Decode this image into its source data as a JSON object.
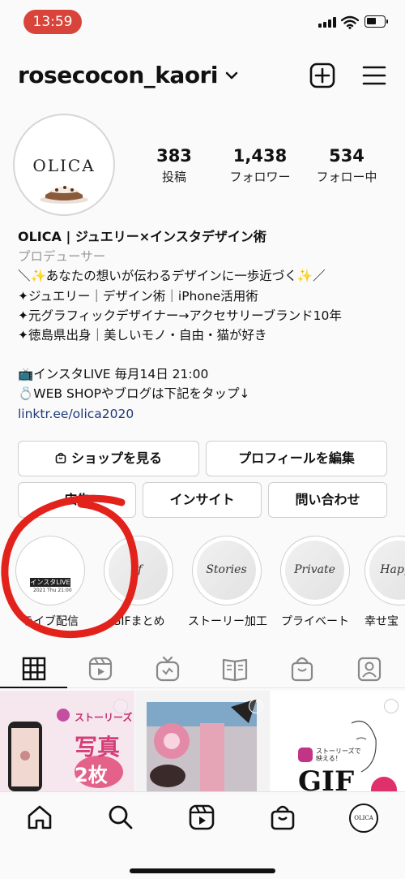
{
  "status": {
    "time": "13:59"
  },
  "header": {
    "username": "rosecocon_kaori"
  },
  "profile": {
    "avatar_logo": "OLICA",
    "stats": [
      {
        "value": "383",
        "label": "投稿"
      },
      {
        "value": "1,438",
        "label": "フォロワー"
      },
      {
        "value": "534",
        "label": "フォロー中"
      }
    ]
  },
  "bio": {
    "name": "OLICA | ジュエリー×インスタデザイン術",
    "category": "プロデューサー",
    "lines": [
      "＼✨あなたの想いが伝わるデザインに一歩近づく✨／",
      "✦ジュエリー｜デザイン術｜iPhone活用術",
      "✦元グラフィックデザイナー→アクセサリーブランド10年",
      "✦徳島県出身｜美しいモノ・自由・猫が好き"
    ],
    "lines2": [
      "📺インスタLIVE 毎月14日 21:00",
      "💍WEB SHOPやブログは下記をタップ↓"
    ],
    "link": "linktr.ee/olica2020"
  },
  "buttons": {
    "shop": "ショップを見る",
    "edit": "プロフィールを編集",
    "ads": "広告",
    "insights": "インサイト",
    "contact": "問い合わせ"
  },
  "highlights": [
    {
      "label": "ライブ配信",
      "cover": "",
      "badge": "インスタLIVE",
      "date": "2021 Thu 21:00"
    },
    {
      "label": "GIFまとめ",
      "cover": "if"
    },
    {
      "label": "ストーリー加工",
      "cover": "Stories"
    },
    {
      "label": "プライベート",
      "cover": "Private"
    },
    {
      "label": "幸せ宝",
      "cover": "Happy"
    }
  ],
  "grid": {
    "post1": {
      "tag": "ストーリーズ",
      "title1": "写真",
      "title2": "2枚"
    },
    "post3": {
      "tag": "ストーリーズで 映える！",
      "title": "GIF"
    }
  },
  "colors": {
    "time_pill": "#d9443a",
    "annotation": "#e2221b",
    "link": "#1d3a78"
  }
}
